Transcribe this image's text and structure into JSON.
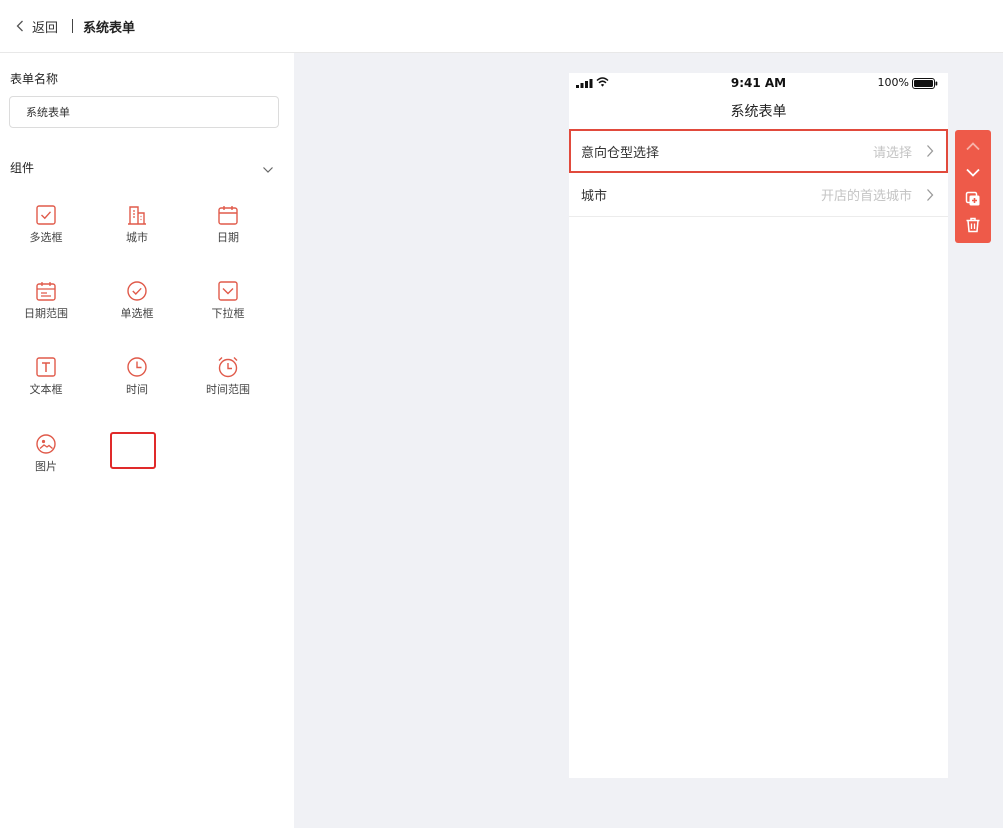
{
  "header": {
    "back_label": "返回",
    "title": "系统表单"
  },
  "left_panel": {
    "form_name_label": "表单名称",
    "form_name_value": "系统表单",
    "components_label": "组件",
    "components": [
      {
        "label": "多选框",
        "icon": "checkbox-icon"
      },
      {
        "label": "城市",
        "icon": "city-building-icon"
      },
      {
        "label": "日期",
        "icon": "calendar-icon"
      },
      {
        "label": "日期范围",
        "icon": "date-range-icon"
      },
      {
        "label": "单选框",
        "icon": "radio-check-icon"
      },
      {
        "label": "下拉框",
        "icon": "dropdown-icon"
      },
      {
        "label": "文本框",
        "icon": "text-box-icon"
      },
      {
        "label": "时间",
        "icon": "clock-icon"
      },
      {
        "label": "时间范围",
        "icon": "alarm-clock-icon"
      },
      {
        "label": "图片",
        "icon": "image-icon"
      }
    ]
  },
  "preview": {
    "status_time": "9:41 AM",
    "battery": "100%",
    "title": "系统表单",
    "fields": [
      {
        "label": "意向仓型选择",
        "placeholder": "请选择",
        "selected": true
      },
      {
        "label": "城市",
        "placeholder": "开店的首选城市",
        "selected": false
      }
    ]
  },
  "toolbar": {
    "buttons": [
      "move-up-icon",
      "move-down-icon",
      "copy-icon",
      "delete-icon"
    ]
  },
  "colors": {
    "accent": "#ee5a49",
    "icon": "#e05a4a",
    "canvas_bg": "#f0f1f5",
    "highlight": "#e02a2a"
  }
}
